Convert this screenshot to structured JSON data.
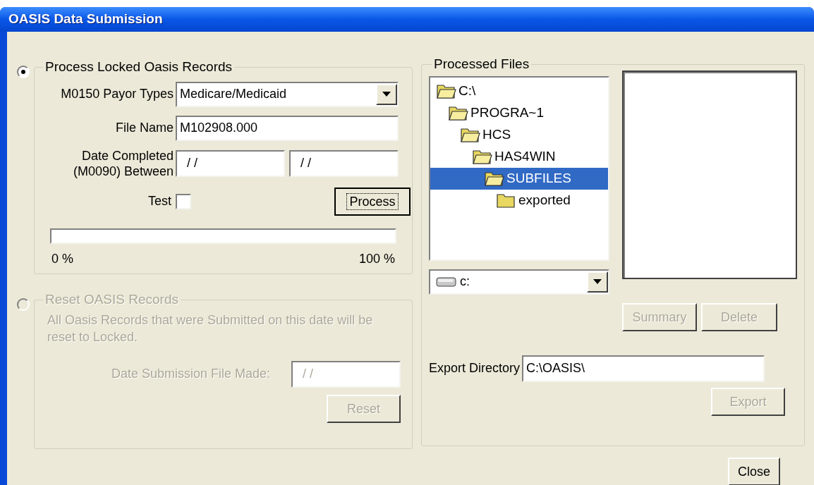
{
  "window": {
    "title": "OASIS Data Submission"
  },
  "process_group": {
    "title": "Process Locked Oasis Records",
    "selected": true,
    "payor_label": "M0150 Payor Types",
    "payor_value": "Medicare/Medicaid",
    "file_name_label": "File Name",
    "file_name_value": "M102908.000",
    "date_label": "Date Completed (M0090) Between",
    "date_from": "/ /",
    "date_to": "/ /",
    "test_label": "Test",
    "test_checked": false,
    "process_button": {
      "label": "Process",
      "disabled": false,
      "focused": true
    },
    "progress": {
      "level": 0,
      "min_label": "0 %",
      "max_label": "100 %"
    }
  },
  "reset_group": {
    "title": "Reset OASIS Records",
    "selected": false,
    "disabled": true,
    "description": "All Oasis Records that were Submitted on this date will be reset to Locked.",
    "date_label": "Date Submission File Made:",
    "date_value": "/ /",
    "reset_button": {
      "label": "Reset",
      "disabled": true
    }
  },
  "processed_files": {
    "title": "Processed Files",
    "tree": [
      {
        "label": "C:\\",
        "expanded": true,
        "selected": false,
        "children": [
          {
            "label": "PROGRA~1",
            "expanded": true,
            "selected": false,
            "children": [
              {
                "label": "HCS",
                "expanded": true,
                "selected": false,
                "children": [
                  {
                    "label": "HAS4WIN",
                    "expanded": true,
                    "selected": false,
                    "children": [
                      {
                        "label": "SUBFILES",
                        "expanded": true,
                        "selected": true,
                        "children": [
                          {
                            "label": "exported",
                            "expanded": false,
                            "selected": false
                          }
                        ]
                      }
                    ]
                  }
                ]
              }
            ]
          }
        ]
      }
    ],
    "drive": "c:",
    "summary_button": {
      "label": "Summary",
      "disabled": true
    },
    "delete_button": {
      "label": "Delete",
      "disabled": true
    },
    "export_label": "Export Directory",
    "export_value": "C:\\OASIS\\",
    "export_button": {
      "label": "Export",
      "disabled": true
    }
  },
  "close_button": {
    "label": "Close",
    "disabled": false
  }
}
